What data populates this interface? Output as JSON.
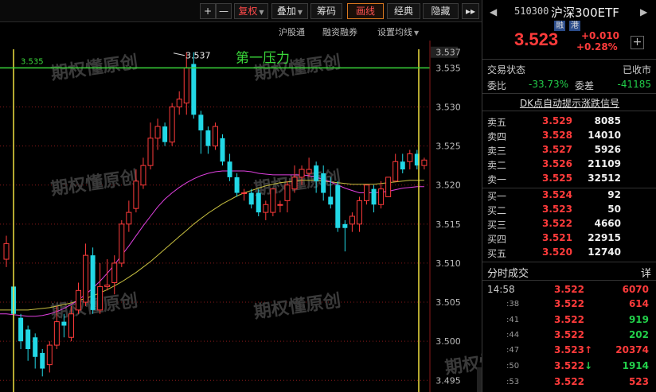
{
  "toolbar": {
    "plus": "+",
    "minus": "—",
    "fuquan": "复权",
    "diejia": "叠加",
    "chouma": "筹码",
    "huaxian": "画线",
    "jingdian": "经典",
    "yincang": "隐藏",
    "expand": "▸▸"
  },
  "subtoolbar": {
    "hugutong": "沪股通",
    "rongzi": "融资融券",
    "junxian": "设置均线"
  },
  "chart_data": {
    "type": "candlestick",
    "y_axis_ticks": [
      "3.537",
      "3.535",
      "3.530",
      "3.525",
      "3.520",
      "3.515",
      "3.510",
      "3.505",
      "3.500",
      "3.495"
    ],
    "ylim": [
      3.4935,
      3.5385
    ],
    "pressure_line": {
      "value": "3.535",
      "label": "第一压力"
    },
    "high_marker": {
      "value": "3.537"
    },
    "watermark": "期权懂原创",
    "candles": [
      [
        3.5105,
        3.5125,
        3.5095,
        3.5135
      ],
      [
        3.507,
        3.5035,
        3.502,
        3.508
      ],
      [
        3.503,
        3.5,
        3.499,
        3.5035
      ],
      [
        3.5015,
        3.499,
        3.4975,
        3.502
      ],
      [
        3.5005,
        3.498,
        3.4965,
        3.501
      ],
      [
        3.4985,
        3.4965,
        3.4955,
        3.499
      ],
      [
        3.497,
        3.4995,
        3.496,
        3.5
      ],
      [
        3.4995,
        3.5025,
        3.499,
        3.5045
      ],
      [
        3.5025,
        3.502,
        3.5005,
        3.5035
      ],
      [
        3.5005,
        3.5035,
        3.5,
        3.5045
      ],
      [
        3.504,
        3.5065,
        3.5035,
        3.5075
      ],
      [
        3.505,
        3.511,
        3.5045,
        3.5125
      ],
      [
        3.511,
        3.504,
        3.5035,
        3.512
      ],
      [
        3.504,
        3.507,
        3.5035,
        3.51
      ],
      [
        3.507,
        3.5072,
        3.5065,
        3.5105
      ],
      [
        3.5075,
        3.51,
        3.506,
        3.511
      ],
      [
        3.51,
        3.515,
        3.5095,
        3.5155
      ],
      [
        3.515,
        3.5165,
        3.514,
        3.518
      ],
      [
        3.517,
        3.5205,
        3.5165,
        3.522
      ],
      [
        3.52,
        3.5225,
        3.5195,
        3.5235
      ],
      [
        3.5225,
        3.526,
        3.522,
        3.528
      ],
      [
        3.526,
        3.5275,
        3.5245,
        3.5285
      ],
      [
        3.5275,
        3.5255,
        3.525,
        3.528
      ],
      [
        3.5255,
        3.53,
        3.525,
        3.5305
      ],
      [
        3.53,
        3.531,
        3.529,
        3.532
      ],
      [
        3.5305,
        3.535,
        3.529,
        3.537
      ],
      [
        3.5355,
        3.529,
        3.5285,
        3.537
      ],
      [
        3.529,
        3.527,
        3.524,
        3.5295
      ],
      [
        3.527,
        3.525,
        3.524,
        3.5275
      ],
      [
        3.525,
        3.5275,
        3.5245,
        3.528
      ],
      [
        3.526,
        3.523,
        3.5225,
        3.5265
      ],
      [
        3.523,
        3.521,
        3.5205,
        3.524
      ],
      [
        3.521,
        3.519,
        3.5185,
        3.5215
      ],
      [
        3.519,
        3.519,
        3.518,
        3.5195
      ],
      [
        3.519,
        3.5175,
        3.517,
        3.5195
      ],
      [
        3.519,
        3.5165,
        3.516,
        3.5195
      ],
      [
        3.5165,
        3.5175,
        3.5155,
        3.518
      ],
      [
        3.5165,
        3.5195,
        3.516,
        3.5195
      ],
      [
        3.5175,
        3.5175,
        3.5165,
        3.518
      ],
      [
        3.518,
        3.52,
        3.5165,
        3.5205
      ],
      [
        3.5195,
        3.521,
        3.519,
        3.5225
      ],
      [
        3.521,
        3.522,
        3.52,
        3.5225
      ],
      [
        3.5215,
        3.522,
        3.521,
        3.5235
      ],
      [
        3.5225,
        3.5205,
        3.519,
        3.523
      ],
      [
        3.5215,
        3.519,
        3.518,
        3.5225
      ],
      [
        3.5185,
        3.5175,
        3.517,
        3.521
      ],
      [
        3.52,
        3.5145,
        3.514,
        3.5205
      ],
      [
        3.515,
        3.5145,
        3.5115,
        3.5155
      ],
      [
        3.515,
        3.516,
        3.514,
        3.5165
      ],
      [
        3.515,
        3.518,
        3.514,
        3.5185
      ],
      [
        3.518,
        3.52,
        3.5175,
        3.52
      ],
      [
        3.5195,
        3.5175,
        3.5165,
        3.52
      ],
      [
        3.5175,
        3.5195,
        3.517,
        3.5205
      ],
      [
        3.5185,
        3.521,
        3.5185,
        3.521
      ],
      [
        3.5205,
        3.523,
        3.5205,
        3.524
      ],
      [
        3.523,
        3.522,
        3.5215,
        3.524
      ],
      [
        3.523,
        3.524,
        3.522,
        3.5245
      ],
      [
        3.524,
        3.5225,
        3.522,
        3.5245
      ],
      [
        3.5225,
        3.5232,
        3.522,
        3.5235
      ]
    ],
    "ma_fast": [
      3.5035,
      3.5034,
      3.5033,
      3.5032,
      3.5032,
      3.5033,
      3.5035,
      3.5038,
      3.5042,
      3.5047,
      3.5053,
      3.506,
      3.5068,
      3.5077,
      3.5087,
      3.5098,
      3.511,
      3.5122,
      3.5135,
      3.5148,
      3.516,
      3.5172,
      3.5182,
      3.519,
      3.5197,
      3.5203,
      3.5208,
      3.5212,
      3.5215,
      3.5217,
      3.5218,
      3.5218,
      3.5218,
      3.5218,
      3.5217,
      3.5215,
      3.5214,
      3.5213,
      3.5213,
      3.5213,
      3.5213,
      3.5213,
      3.5212,
      3.521,
      3.5207,
      3.5204,
      3.52,
      3.5196,
      3.5193,
      3.519,
      3.519,
      3.519,
      3.5191,
      3.5192,
      3.5194,
      3.5196,
      3.5197,
      3.5198,
      3.5198
    ],
    "ma_slow": [
      3.504,
      3.504,
      3.504,
      3.504,
      3.5041,
      3.5042,
      3.5043,
      3.5045,
      3.5047,
      3.5049,
      3.5052,
      3.5055,
      3.5058,
      3.5062,
      3.5066,
      3.5071,
      3.5076,
      3.5082,
      3.5088,
      3.5095,
      3.5102,
      3.511,
      3.5118,
      3.5126,
      3.5134,
      3.5142,
      3.515,
      3.5157,
      3.5164,
      3.517,
      3.5176,
      3.5181,
      3.5186,
      3.519,
      3.5193,
      3.5196,
      3.5199,
      3.5201,
      3.5203,
      3.5204,
      3.5205,
      3.5206,
      3.5206,
      3.5206,
      3.5205,
      3.5204,
      3.5203,
      3.5202,
      3.5201,
      3.5201,
      3.5201,
      3.5201,
      3.5202,
      3.5203,
      3.5204,
      3.5205,
      3.5206,
      3.5206,
      3.5206
    ],
    "colors": {
      "up": "#ff3b3b",
      "down": "#22d8e6",
      "ma_fast": "#e040e0",
      "ma_slow": "#c8c040",
      "pressure": "#3ad83a",
      "vline": "#f0e040",
      "grid": "#8a1a1a"
    }
  },
  "panel": {
    "code": "510300",
    "name": "沪深300ETF",
    "tag1": "融",
    "tag2": "港",
    "price": "3.523",
    "change": "+0.010",
    "change_pct": "+0.28%",
    "add": "+",
    "trade_status_label": "交易状态",
    "trade_status_value": "已收市",
    "weibi_label": "委比",
    "weibi_value": "-33.73%",
    "weicha_label": "委差",
    "weicha_value": "-41185",
    "dk_link": "DK点自动提示涨跌信号",
    "asks": [
      {
        "label": "卖五",
        "price": "3.529",
        "vol": "8085"
      },
      {
        "label": "卖四",
        "price": "3.528",
        "vol": "14010"
      },
      {
        "label": "卖三",
        "price": "3.527",
        "vol": "5926"
      },
      {
        "label": "卖二",
        "price": "3.526",
        "vol": "21109"
      },
      {
        "label": "卖一",
        "price": "3.525",
        "vol": "32512"
      }
    ],
    "bids": [
      {
        "label": "买一",
        "price": "3.524",
        "vol": "92"
      },
      {
        "label": "买二",
        "price": "3.523",
        "vol": "50"
      },
      {
        "label": "买三",
        "price": "3.522",
        "vol": "4660"
      },
      {
        "label": "买四",
        "price": "3.521",
        "vol": "22915"
      },
      {
        "label": "买五",
        "price": "3.520",
        "vol": "12740"
      }
    ],
    "ticks_title": "分时成交",
    "ticks_detail": "详",
    "ticks": [
      {
        "time": "14:58",
        "price": "3.522",
        "arrow": "",
        "vol": "6070",
        "vol_color": "red"
      },
      {
        "time": ":38",
        "price": "3.522",
        "arrow": "",
        "vol": "614",
        "vol_color": "red"
      },
      {
        "time": ":41",
        "price": "3.522",
        "arrow": "",
        "vol": "919",
        "vol_color": "green"
      },
      {
        "time": ":44",
        "price": "3.522",
        "arrow": "",
        "vol": "202",
        "vol_color": "green"
      },
      {
        "time": ":47",
        "price": "3.523",
        "arrow": "↑",
        "vol": "20374",
        "vol_color": "red"
      },
      {
        "time": ":50",
        "price": "3.522",
        "arrow": "↓",
        "vol": "1914",
        "vol_color": "green"
      },
      {
        "time": ":53",
        "price": "3.522",
        "arrow": "",
        "vol": "523",
        "vol_color": "red"
      }
    ]
  }
}
